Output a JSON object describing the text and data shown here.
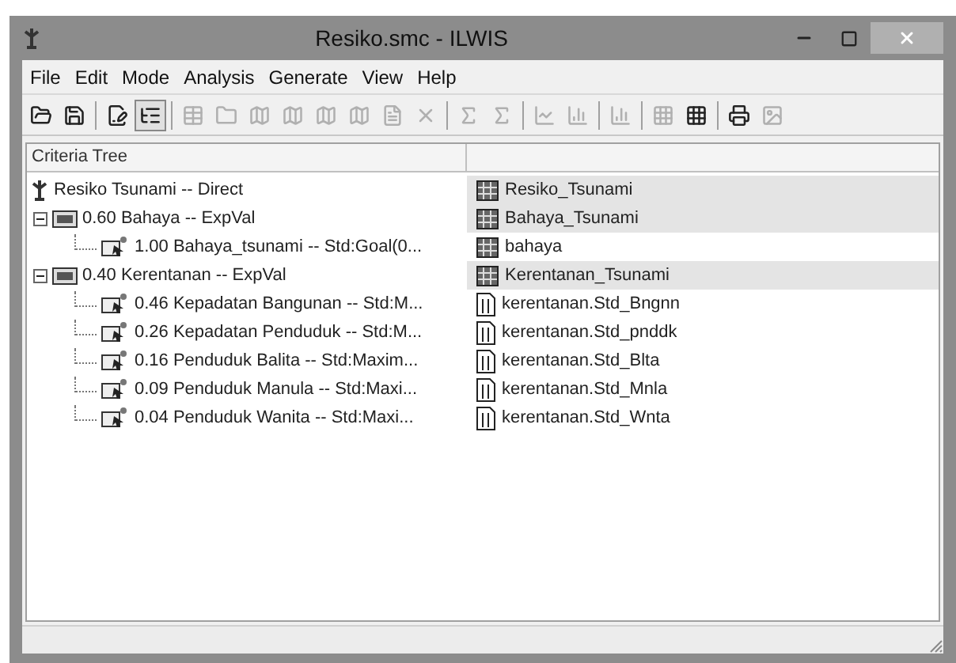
{
  "window": {
    "title": "Resiko.smc - ILWIS"
  },
  "menu": [
    "File",
    "Edit",
    "Mode",
    "Analysis",
    "Generate",
    "View",
    "Help"
  ],
  "toolbar": [
    {
      "kind": "button",
      "pressed": false,
      "disabled": false
    },
    {
      "kind": "button",
      "pressed": false,
      "disabled": false
    },
    {
      "kind": "separator"
    },
    {
      "kind": "button",
      "pressed": false,
      "disabled": false
    },
    {
      "kind": "button",
      "pressed": true,
      "disabled": false
    },
    {
      "kind": "separator"
    },
    {
      "kind": "button",
      "pressed": false,
      "disabled": true
    },
    {
      "kind": "button",
      "pressed": false,
      "disabled": true
    },
    {
      "kind": "button",
      "pressed": false,
      "disabled": true
    },
    {
      "kind": "button",
      "pressed": false,
      "disabled": true
    },
    {
      "kind": "button",
      "pressed": false,
      "disabled": true
    },
    {
      "kind": "button",
      "pressed": false,
      "disabled": true
    },
    {
      "kind": "button",
      "pressed": false,
      "disabled": true
    },
    {
      "kind": "button",
      "pressed": false,
      "disabled": true
    },
    {
      "kind": "separator"
    },
    {
      "kind": "button",
      "pressed": false,
      "disabled": true
    },
    {
      "kind": "button",
      "pressed": false,
      "disabled": true
    },
    {
      "kind": "separator"
    },
    {
      "kind": "button",
      "pressed": false,
      "disabled": true
    },
    {
      "kind": "button",
      "pressed": false,
      "disabled": true
    },
    {
      "kind": "separator"
    },
    {
      "kind": "button",
      "pressed": false,
      "disabled": true
    },
    {
      "kind": "separator"
    },
    {
      "kind": "button",
      "pressed": false,
      "disabled": true
    },
    {
      "kind": "button",
      "pressed": false,
      "disabled": false
    },
    {
      "kind": "separator"
    },
    {
      "kind": "button",
      "pressed": false,
      "disabled": false
    },
    {
      "kind": "button",
      "pressed": false,
      "disabled": true
    }
  ],
  "tree": {
    "columns": [
      "Criteria Tree"
    ],
    "nodes": [
      {
        "kind": "goal",
        "label": "Resiko Tsunami -- Direct",
        "output": {
          "kind": "map",
          "name": "Resiko_Tsunami"
        },
        "children": [
          {
            "kind": "group",
            "label": "0.60 Bahaya -- ExpVal",
            "output": {
              "kind": "map",
              "name": "Bahaya_Tsunami"
            },
            "expanded": true,
            "children": [
              {
                "kind": "factor",
                "label": "1.00 Bahaya_tsunami -- Std:Goal(0...",
                "output": {
                  "kind": "map",
                  "name": "bahaya"
                }
              }
            ]
          },
          {
            "kind": "group",
            "label": "0.40 Kerentanan -- ExpVal",
            "output": {
              "kind": "map",
              "name": "Kerentanan_Tsunami"
            },
            "expanded": true,
            "children": [
              {
                "kind": "factor",
                "label": "0.46 Kepadatan Bangunan -- Std:M...",
                "output": {
                  "kind": "column",
                  "name": "kerentanan.Std_Bngnn"
                }
              },
              {
                "kind": "factor",
                "label": "0.26 Kepadatan Penduduk -- Std:M...",
                "output": {
                  "kind": "column",
                  "name": "kerentanan.Std_pnddk"
                }
              },
              {
                "kind": "factor",
                "label": "0.16 Penduduk Balita -- Std:Maxim...",
                "output": {
                  "kind": "column",
                  "name": "kerentanan.Std_Blta"
                }
              },
              {
                "kind": "factor",
                "label": "0.09 Penduduk Manula -- Std:Maxi...",
                "output": {
                  "kind": "column",
                  "name": "kerentanan.Std_Mnla"
                }
              },
              {
                "kind": "factor",
                "label": "0.04 Penduduk Wanita -- Std:Maxi...",
                "output": {
                  "kind": "column",
                  "name": "kerentanan.Std_Wnta"
                }
              }
            ]
          }
        ]
      }
    ]
  }
}
